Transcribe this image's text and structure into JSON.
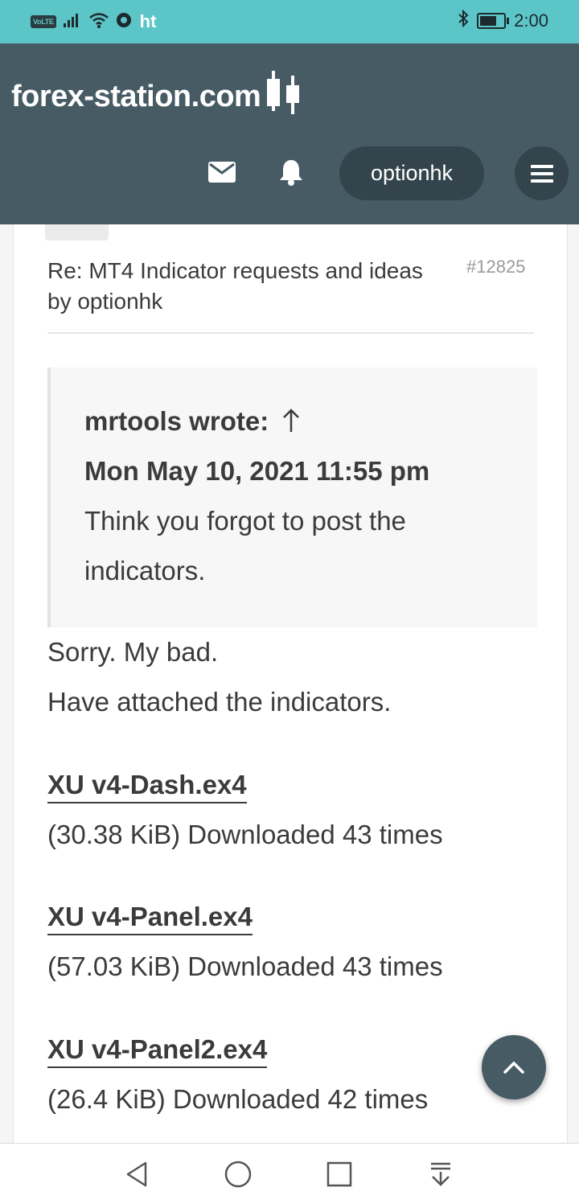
{
  "status_bar": {
    "volte": "VoLTE",
    "carrier": "ht",
    "time": "2:00"
  },
  "header": {
    "logo_text": "forex-station.com",
    "username": "optionhk"
  },
  "post": {
    "title": "Re: MT4 Indicator requests and ideas",
    "post_number": "#12825",
    "byline": "by optionhk",
    "quote": {
      "author_line": "mrtools wrote:",
      "date": "Mon May 10, 2021 11:55 pm",
      "text_line1": "Think you forgot to post the",
      "text_line2": "indicators."
    },
    "body_line1": "Sorry. My bad.",
    "body_line2": "Have attached the indicators.",
    "attachments": [
      {
        "name": "XU v4-Dash.ex4",
        "meta": "(30.38 KiB) Downloaded 43 times"
      },
      {
        "name": "XU v4-Panel.ex4",
        "meta": "(57.03 KiB) Downloaded 43 times"
      },
      {
        "name": "XU v4-Panel2.ex4",
        "meta": "(26.4 KiB) Downloaded 42 times"
      }
    ]
  },
  "colors": {
    "status_bar": "#5cc5c7",
    "header": "#475b65",
    "pill": "#33444c"
  }
}
